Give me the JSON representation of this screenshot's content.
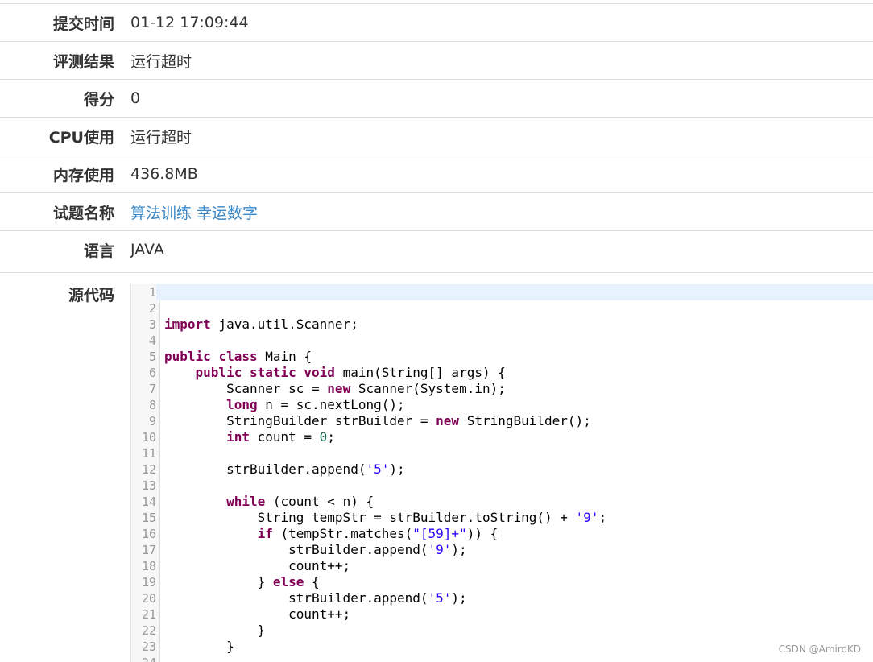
{
  "fields": [
    {
      "label": "提交时间",
      "value": "01-12 17:09:44"
    },
    {
      "label": "评测结果",
      "value": "运行超时"
    },
    {
      "label": "得分",
      "value": "0"
    },
    {
      "label": "CPU使用",
      "value": "运行超时"
    },
    {
      "label": "内存使用",
      "value": "436.8MB"
    },
    {
      "label": "试题名称",
      "value": "算法训练 幸运数字",
      "link": true
    },
    {
      "label": "语言",
      "value": "JAVA"
    }
  ],
  "source": {
    "label": "源代码",
    "lines": [
      "",
      "",
      "import java.util.Scanner;",
      "",
      "public class Main {",
      "    public static void main(String[] args) {",
      "        Scanner sc = new Scanner(System.in);",
      "        long n = sc.nextLong();",
      "        StringBuilder strBuilder = new StringBuilder();",
      "        int count = 0;",
      "",
      "        strBuilder.append('5');",
      "",
      "        while (count < n) {",
      "            String tempStr = strBuilder.toString() + '9';",
      "            if (tempStr.matches(\"[59]+\")) {",
      "                strBuilder.append('9');",
      "                count++;",
      "            } else {",
      "                strBuilder.append('5');",
      "                count++;",
      "            }",
      "        }",
      ""
    ]
  },
  "watermark": "CSDN @AmiroKD",
  "colors": {
    "link": "#3a86c4",
    "keyword": "#7f0055",
    "string": "#2a00ff",
    "number": "#116644",
    "active_line": "#e8f2fe"
  }
}
